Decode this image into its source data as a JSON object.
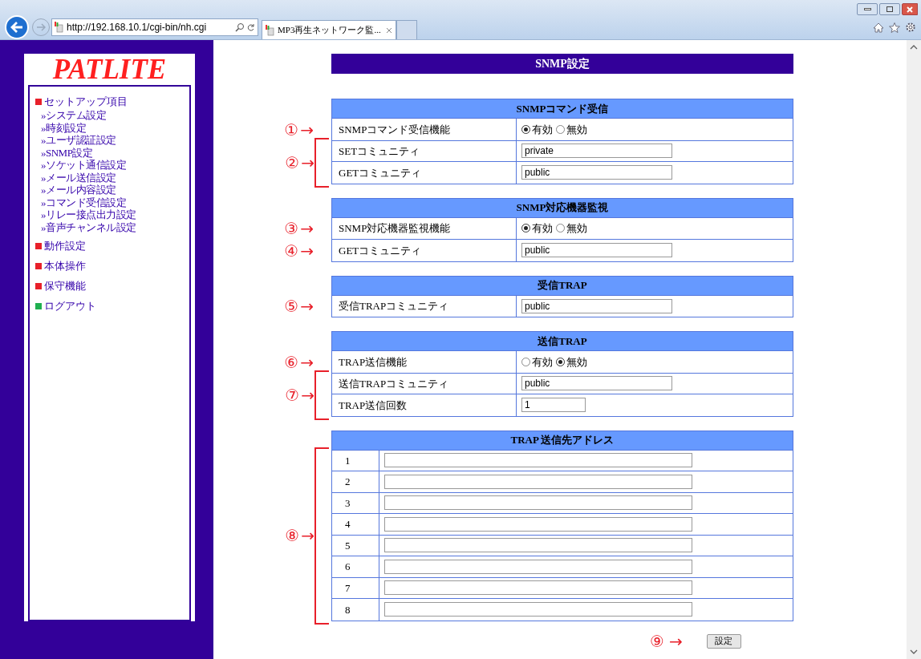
{
  "browser": {
    "address": "http://192.168.10.1/cgi-bin/nh.cgi",
    "tab_title": "MP3再生ネットワーク監..."
  },
  "sidebar": {
    "logo": "PATLITE",
    "items": [
      {
        "label": "セットアップ項目",
        "color": "#e8202a",
        "children": [
          {
            "label": "»システム設定"
          },
          {
            "label": "»時刻設定"
          },
          {
            "label": "»ユーザ認証設定"
          },
          {
            "label": "»SNMP設定"
          },
          {
            "label": "»ソケット通信設定"
          },
          {
            "label": "»メール送信設定"
          },
          {
            "label": "»メール内容設定"
          },
          {
            "label": "»コマンド受信設定"
          },
          {
            "label": "»リレー接点出力設定"
          },
          {
            "label": "»音声チャンネル設定"
          }
        ]
      },
      {
        "label": "動作設定",
        "color": "#e8202a"
      },
      {
        "label": "本体操作",
        "color": "#e8202a"
      },
      {
        "label": "保守機能",
        "color": "#e8202a"
      },
      {
        "label": "ログアウト",
        "color": "#20b050"
      }
    ]
  },
  "page_title": "SNMP設定",
  "sections": [
    {
      "kind": "form",
      "title": "SNMPコマンド受信",
      "groups": [
        {
          "annotation": {
            "number": "①",
            "arrow": "→"
          },
          "bracket": false,
          "rows": [
            {
              "kind": "radio",
              "label": "SNMPコマンド受信機能",
              "options": [
                {
                  "label": "有効",
                  "selected": true
                },
                {
                  "label": "無効",
                  "selected": false
                }
              ]
            }
          ]
        },
        {
          "annotation": {
            "number": "②",
            "arrow": "→"
          },
          "bracket": true,
          "rows": [
            {
              "kind": "text",
              "label": "SETコミュニティ",
              "value": "private"
            },
            {
              "kind": "text",
              "label": "GETコミュニティ",
              "value": "public"
            }
          ]
        }
      ]
    },
    {
      "kind": "form",
      "title": "SNMP対応機器監視",
      "groups": [
        {
          "annotation": {
            "number": "③",
            "arrow": "→"
          },
          "bracket": false,
          "rows": [
            {
              "kind": "radio",
              "label": "SNMP対応機器監視機能",
              "options": [
                {
                  "label": "有効",
                  "selected": true
                },
                {
                  "label": "無効",
                  "selected": false
                }
              ]
            }
          ]
        },
        {
          "annotation": {
            "number": "④",
            "arrow": "→"
          },
          "bracket": false,
          "rows": [
            {
              "kind": "text",
              "label": "GETコミュニティ",
              "value": "public"
            }
          ]
        }
      ]
    },
    {
      "kind": "form",
      "title": "受信TRAP",
      "groups": [
        {
          "annotation": {
            "number": "⑤",
            "arrow": "→"
          },
          "bracket": false,
          "rows": [
            {
              "kind": "text",
              "label": "受信TRAPコミュニティ",
              "value": "public"
            }
          ]
        }
      ]
    },
    {
      "kind": "form",
      "title": "送信TRAP",
      "groups": [
        {
          "annotation": {
            "number": "⑥",
            "arrow": "→"
          },
          "bracket": false,
          "rows": [
            {
              "kind": "radio",
              "label": "TRAP送信機能",
              "options": [
                {
                  "label": "有効",
                  "selected": false
                },
                {
                  "label": "無効",
                  "selected": true
                }
              ]
            }
          ]
        },
        {
          "annotation": {
            "number": "⑦",
            "arrow": "→"
          },
          "bracket": true,
          "rows": [
            {
              "kind": "text",
              "label": "送信TRAPコミュニティ",
              "value": "public"
            },
            {
              "kind": "count",
              "label": "TRAP送信回数",
              "value": "1"
            }
          ]
        }
      ]
    },
    {
      "kind": "address_list",
      "title": "TRAP 送信先アドレス",
      "groups": [
        {
          "annotation": {
            "number": "⑧",
            "arrow": "→"
          },
          "bracket": true,
          "rows": [
            {
              "kind": "address",
              "label": "1"
            },
            {
              "kind": "address",
              "label": "2"
            },
            {
              "kind": "address",
              "label": "3"
            },
            {
              "kind": "address",
              "label": "4"
            },
            {
              "kind": "address",
              "label": "5"
            },
            {
              "kind": "address",
              "label": "6"
            },
            {
              "kind": "address",
              "label": "7"
            },
            {
              "kind": "address",
              "label": "8"
            }
          ]
        }
      ]
    }
  ],
  "submit": {
    "annotation": {
      "number": "⑨",
      "arrow": "→"
    },
    "label": "設定"
  }
}
